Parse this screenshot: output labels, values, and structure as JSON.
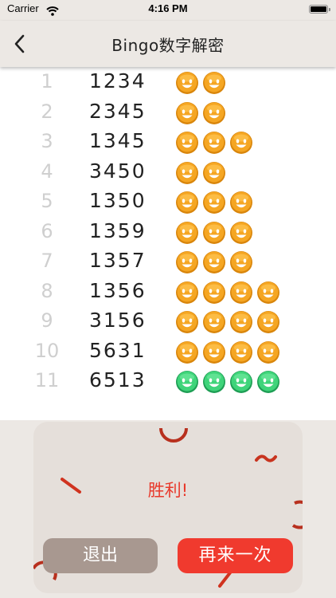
{
  "status_bar": {
    "carrier": "Carrier",
    "time": "4:16 PM"
  },
  "nav": {
    "title": "Bingo数字解密",
    "back_icon": "chevron-left-icon"
  },
  "rows": [
    {
      "index": "1",
      "number": "1234",
      "faces": [
        "orange",
        "orange"
      ]
    },
    {
      "index": "2",
      "number": "2345",
      "faces": [
        "orange",
        "orange"
      ]
    },
    {
      "index": "3",
      "number": "1345",
      "faces": [
        "orange",
        "orange",
        "orange"
      ]
    },
    {
      "index": "4",
      "number": "3450",
      "faces": [
        "orange",
        "orange"
      ]
    },
    {
      "index": "5",
      "number": "1350",
      "faces": [
        "orange",
        "orange",
        "orange"
      ]
    },
    {
      "index": "6",
      "number": "1359",
      "faces": [
        "orange",
        "orange",
        "orange"
      ]
    },
    {
      "index": "7",
      "number": "1357",
      "faces": [
        "orange",
        "orange",
        "orange"
      ]
    },
    {
      "index": "8",
      "number": "1356",
      "faces": [
        "orange",
        "orange",
        "orange",
        "orange"
      ]
    },
    {
      "index": "9",
      "number": "3156",
      "faces": [
        "orange",
        "orange",
        "orange",
        "orange"
      ]
    },
    {
      "index": "10",
      "number": "5631",
      "faces": [
        "orange",
        "orange",
        "orange",
        "orange"
      ]
    },
    {
      "index": "11",
      "number": "6513",
      "faces": [
        "green",
        "green",
        "green",
        "green"
      ]
    }
  ],
  "dialog": {
    "result": "胜利!",
    "exit_label": "退出",
    "again_label": "再来一次"
  },
  "colors": {
    "orange": "#f5a623",
    "green": "#3fd47a",
    "accent": "#f03a2e",
    "exit": "#a89890"
  }
}
